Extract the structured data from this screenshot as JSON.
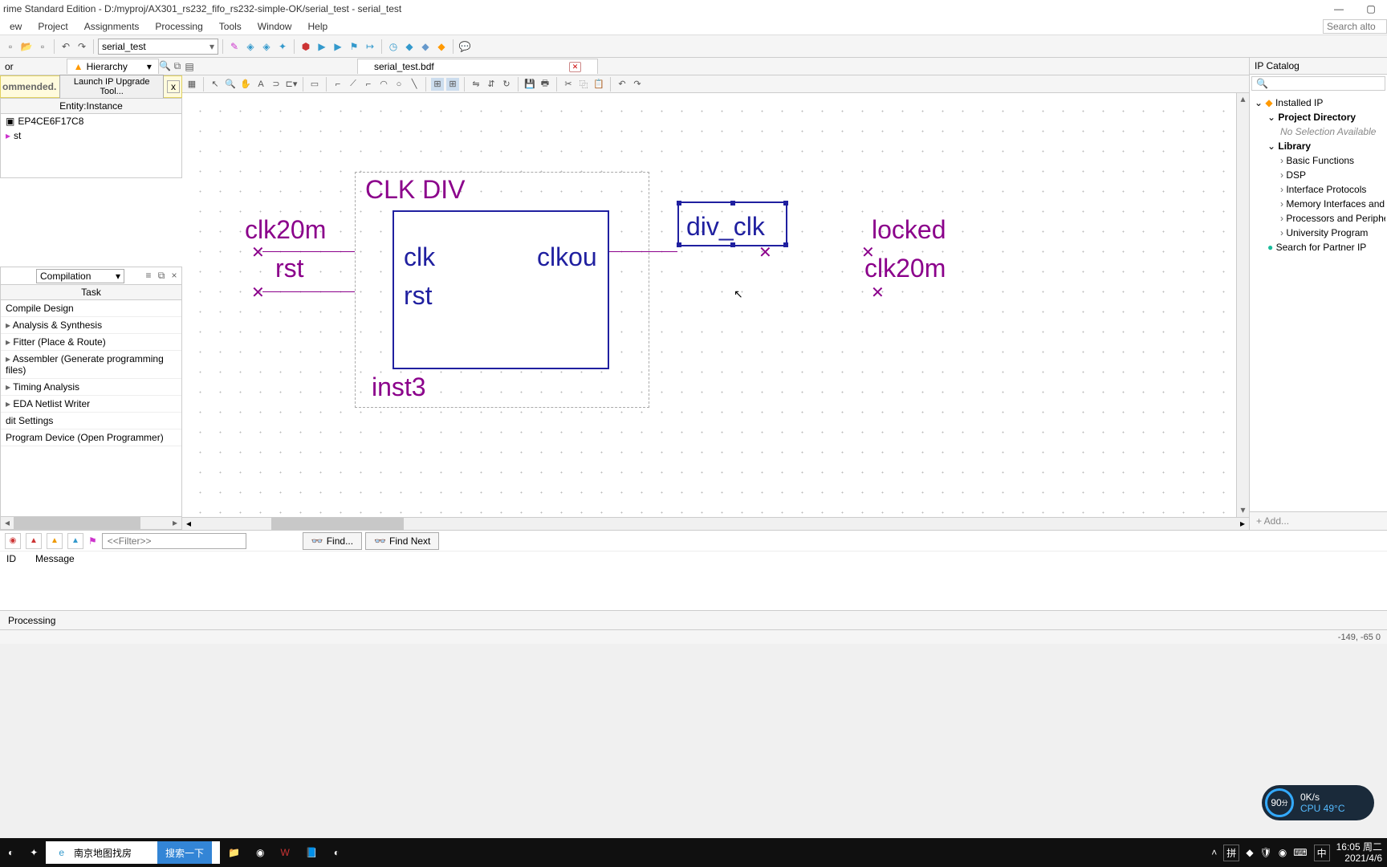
{
  "title": "rime Standard Edition - D:/myproj/AX301_rs232_fifo_rs232-simple-OK/serial_test - serial_test",
  "menus": [
    "ew",
    "Project",
    "Assignments",
    "Processing",
    "Tools",
    "Window",
    "Help"
  ],
  "search_alt_placeholder": "Search alto",
  "project_combo": "serial_test",
  "hierarchy_tab": "Hierarchy",
  "upgrade": {
    "rec": "ommended.",
    "btn": "Launch IP Upgrade Tool...",
    "close": "x"
  },
  "entity": {
    "header": "Entity:Instance",
    "device": "EP4CE6F17C8",
    "inst": "st"
  },
  "tasks": {
    "combo": "Compilation",
    "header": "Task",
    "items": [
      {
        "t": "Compile Design",
        "sub": false
      },
      {
        "t": "Analysis & Synthesis",
        "sub": true
      },
      {
        "t": "Fitter (Place & Route)",
        "sub": true
      },
      {
        "t": "Assembler (Generate programming files)",
        "sub": true
      },
      {
        "t": "Timing Analysis",
        "sub": true
      },
      {
        "t": "EDA Netlist Writer",
        "sub": true
      },
      {
        "t": "dit Settings",
        "sub": false
      },
      {
        "t": "Program Device (Open Programmer)",
        "sub": false
      }
    ]
  },
  "doc_tab": "serial_test.bdf",
  "schematic": {
    "title": "CLK  DIV",
    "p1": "clk",
    "p2": "rst",
    "po": "clkou",
    "inst": "inst3",
    "left_sig": "clk20m",
    "left_sig2": "rst",
    "sel": "div_clk",
    "right1": "locked",
    "right2": "clk20m"
  },
  "ip": {
    "title": "IP Catalog",
    "root": "Installed IP",
    "groups": [
      "Project Directory",
      "Library"
    ],
    "nosel": "No Selection Available",
    "lib": [
      "Basic Functions",
      "DSP",
      "Interface Protocols",
      "Memory Interfaces and C",
      "Processors and Periphera",
      "University Program"
    ],
    "search": "Search for Partner IP",
    "add": "+   Add..."
  },
  "msg": {
    "filter_placeholder": "<<Filter>>",
    "find": "Find...",
    "findnext": "Find Next",
    "col1": "ID",
    "col2": "Message"
  },
  "status_tab": "Processing",
  "coord": "-149, -65  0",
  "perf": {
    "score": "90",
    "unit": "分",
    "net": "0K/s",
    "cpu": "CPU 49°C"
  },
  "taskbar": {
    "browser_text": "南京地图找房",
    "search_btn": "搜索一下",
    "ime1": "拼",
    "ime2": "中",
    "time": "16:05",
    "day": "周二",
    "date": "2021/4/6"
  }
}
